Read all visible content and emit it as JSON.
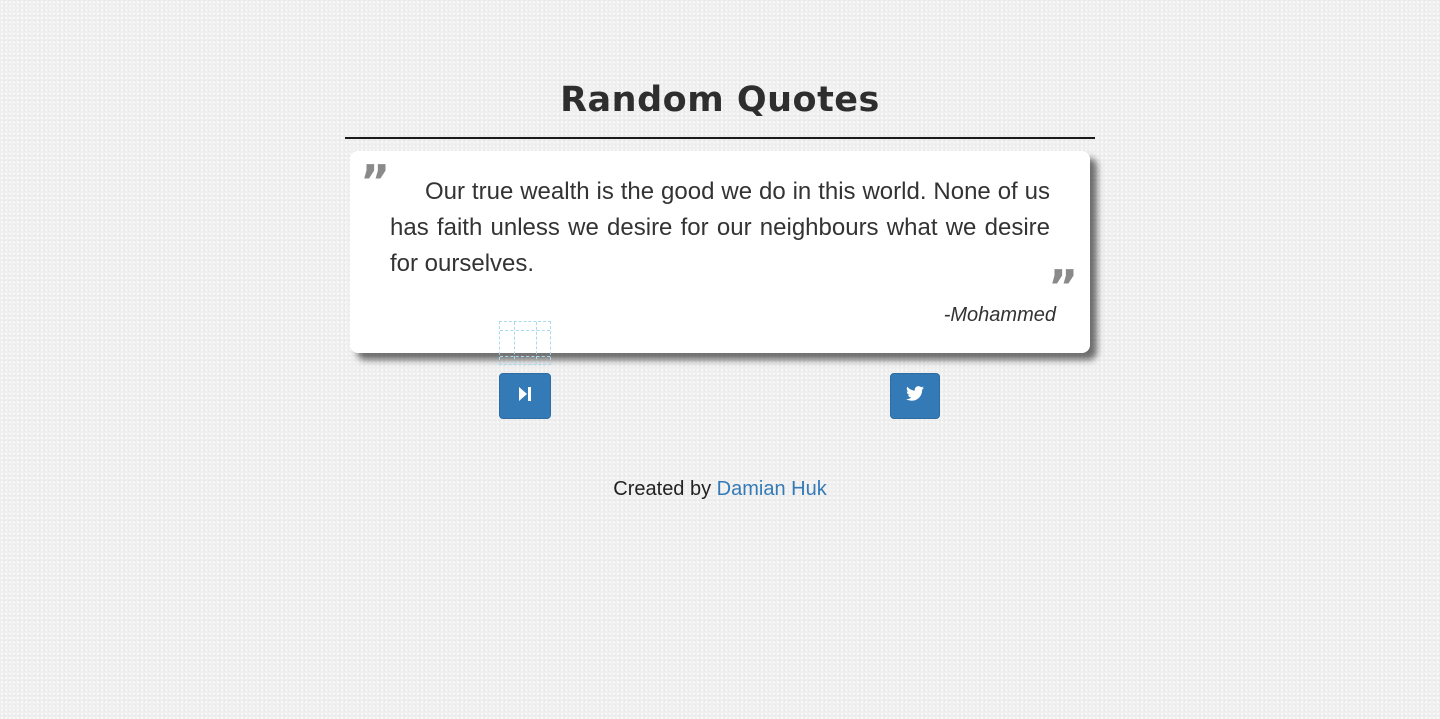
{
  "header": {
    "title": "Random Quotes"
  },
  "quote": {
    "open_mark": "”",
    "close_mark": "”",
    "text": "Our true wealth is the good we do in this world. None of us has faith unless we desire for our neighbours what we desire for ourselves.",
    "author": "-Mohammed"
  },
  "buttons": {
    "next_icon": "step-forward-icon",
    "tweet_icon": "twitter-icon"
  },
  "footer": {
    "prefix": "Created by ",
    "author_link": "Damian Huk"
  },
  "colors": {
    "accent": "#337ab7",
    "background": "#efefef",
    "card": "#ffffff",
    "quote_mark": "#8a8a8a"
  }
}
